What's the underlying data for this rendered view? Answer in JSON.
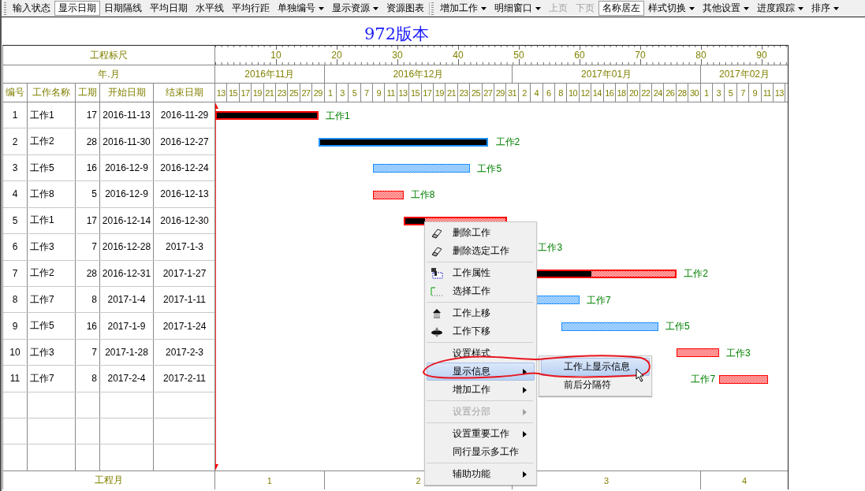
{
  "toolbar": {
    "items": [
      {
        "kind": "button",
        "label": "输入状态",
        "dropdown": false,
        "pressed": false,
        "disabled": false
      },
      {
        "kind": "button",
        "label": "显示日期",
        "dropdown": false,
        "pressed": true,
        "disabled": false
      },
      {
        "kind": "button",
        "label": "日期隔线",
        "dropdown": false,
        "pressed": false,
        "disabled": false
      },
      {
        "kind": "button",
        "label": "平均日期",
        "dropdown": false,
        "pressed": false,
        "disabled": false
      },
      {
        "kind": "button",
        "label": "水平线",
        "dropdown": false,
        "pressed": false,
        "disabled": false
      },
      {
        "kind": "button",
        "label": "平均行距",
        "dropdown": false,
        "pressed": false,
        "disabled": false
      },
      {
        "kind": "button",
        "label": "单独编号",
        "dropdown": true,
        "pressed": false,
        "disabled": false
      },
      {
        "kind": "button",
        "label": "显示资源",
        "dropdown": true,
        "pressed": false,
        "disabled": false
      },
      {
        "kind": "button",
        "label": "资源图表",
        "dropdown": false,
        "pressed": false,
        "disabled": false
      },
      {
        "kind": "separator"
      },
      {
        "kind": "button",
        "label": "增加工作",
        "dropdown": true,
        "pressed": false,
        "disabled": false
      },
      {
        "kind": "button",
        "label": "明细窗口",
        "dropdown": true,
        "pressed": false,
        "disabled": false
      },
      {
        "kind": "button",
        "label": "上页",
        "dropdown": false,
        "pressed": false,
        "disabled": true
      },
      {
        "kind": "button",
        "label": "下页",
        "dropdown": false,
        "pressed": false,
        "disabled": true
      },
      {
        "kind": "button",
        "label": "名称居左",
        "dropdown": false,
        "pressed": true,
        "disabled": false
      },
      {
        "kind": "button",
        "label": "样式切换",
        "dropdown": true,
        "pressed": false,
        "disabled": false
      },
      {
        "kind": "button",
        "label": "其他设置",
        "dropdown": true,
        "pressed": false,
        "disabled": false
      },
      {
        "kind": "button",
        "label": "进度跟踪",
        "dropdown": true,
        "pressed": false,
        "disabled": false
      },
      {
        "kind": "button",
        "label": "排序",
        "dropdown": true,
        "pressed": false,
        "disabled": false
      }
    ]
  },
  "title": "972版本",
  "header": {
    "ruler_title": "工程标尺",
    "month_title": "年.月",
    "columns": [
      "编号",
      "工作名称",
      "工期",
      "开始日期",
      "结束日期"
    ]
  },
  "timeline": {
    "ruler": [
      "10",
      "20",
      "30",
      "40",
      "50",
      "60",
      "70",
      "80",
      "90"
    ],
    "months": [
      {
        "label": "2016年11月"
      },
      {
        "label": "2016年12月"
      },
      {
        "label": "2017年01月"
      },
      {
        "label": "2017年02月"
      }
    ],
    "days": [
      "13",
      "15",
      "17",
      "19",
      "21",
      "23",
      "25",
      "27",
      "29",
      "1",
      "3",
      "5",
      "7",
      "9",
      "11",
      "13",
      "15",
      "17",
      "19",
      "21",
      "23",
      "25",
      "27",
      "29",
      "31",
      "2",
      "4",
      "6",
      "8",
      "10",
      "12",
      "14",
      "16",
      "18",
      "20",
      "22",
      "24",
      "26",
      "28",
      "30",
      "1",
      "3",
      "5",
      "7",
      "9",
      "11",
      "13"
    ]
  },
  "rows": [
    {
      "no": "1",
      "name": "工作1",
      "duration": "17",
      "start": "2016-11-13",
      "end": "2016-11-29",
      "critical": true,
      "level": 1,
      "bar_label": "工作1"
    },
    {
      "no": "2",
      "name": "工作2",
      "duration": "28",
      "start": "2016-11-30",
      "end": "2016-12-27",
      "critical": false,
      "level": 1,
      "bar_label": "工作2"
    },
    {
      "no": "3",
      "name": "工作5",
      "duration": "16",
      "start": "2016-12-9",
      "end": "2016-12-24",
      "critical": false,
      "bar_label": "工作5"
    },
    {
      "no": "4",
      "name": "工作8",
      "duration": "5",
      "start": "2016-12-9",
      "end": "2016-12-13",
      "critical": true,
      "bar_label": "工作8"
    },
    {
      "no": "5",
      "name": "工作1",
      "duration": "17",
      "start": "2016-12-14",
      "end": "2016-12-30",
      "critical": true,
      "level": 0.2
    },
    {
      "no": "6",
      "name": "工作3",
      "duration": "7",
      "start": "2016-12-28",
      "end": "2017-1-3",
      "bar_label": "工作3"
    },
    {
      "no": "7",
      "name": "工作2",
      "duration": "28",
      "start": "2016-12-31",
      "end": "2017-1-27",
      "critical": true,
      "level": 0.5,
      "bar_label": "工作2"
    },
    {
      "no": "8",
      "name": "工作7",
      "duration": "8",
      "start": "2017-1-4",
      "end": "2017-1-11",
      "critical": false,
      "bar_label": "工作7"
    },
    {
      "no": "9",
      "name": "工作5",
      "duration": "16",
      "start": "2017-1-9",
      "end": "2017-1-24",
      "critical": false,
      "bar_label": "工作5"
    },
    {
      "no": "10",
      "name": "工作3",
      "duration": "7",
      "start": "2017-1-28",
      "end": "2017-2-3",
      "critical": true,
      "bar_label": "工作3"
    },
    {
      "no": "11",
      "name": "工作7",
      "duration": "8",
      "start": "2017-2-4",
      "end": "2017-2-11",
      "critical": true,
      "bar_label": "工作7"
    }
  ],
  "footer": {
    "title": "工程月",
    "months": [
      "1",
      "2",
      "3",
      "4"
    ]
  },
  "context_menu": {
    "items": [
      {
        "kind": "item",
        "label": "删除工作",
        "disabled": false,
        "selected": false
      },
      {
        "kind": "item",
        "label": "删除选定工作",
        "disabled": false,
        "selected": false
      },
      {
        "kind": "separator"
      },
      {
        "kind": "item",
        "label": "工作属性",
        "disabled": false,
        "selected": false
      },
      {
        "kind": "item",
        "label": "选择工作",
        "disabled": false,
        "selected": false
      },
      {
        "kind": "separator"
      },
      {
        "kind": "item",
        "label": "工作上移",
        "disabled": false,
        "selected": false
      },
      {
        "kind": "item",
        "label": "工作下移",
        "disabled": false,
        "selected": false
      },
      {
        "kind": "separator"
      },
      {
        "kind": "item",
        "label": "设置样式",
        "disabled": false,
        "selected": false
      },
      {
        "kind": "item",
        "label": "显示信息",
        "submenu": true,
        "disabled": false,
        "selected": true
      },
      {
        "kind": "item",
        "label": "增加工作",
        "submenu": true,
        "disabled": false,
        "selected": false
      },
      {
        "kind": "separator"
      },
      {
        "kind": "item",
        "label": "设置分部",
        "submenu": true,
        "disabled": true,
        "selected": false
      },
      {
        "kind": "separator"
      },
      {
        "kind": "item",
        "label": "设置重要工作",
        "submenu": true,
        "disabled": false,
        "selected": false
      },
      {
        "kind": "item",
        "label": "同行显示多工作",
        "disabled": false,
        "selected": false
      },
      {
        "kind": "separator"
      },
      {
        "kind": "item",
        "label": "辅助功能",
        "submenu": true,
        "disabled": false,
        "selected": false
      }
    ]
  },
  "submenu": {
    "items": [
      {
        "kind": "item",
        "label": "工作上显示信息",
        "disabled": false,
        "selected": true
      },
      {
        "kind": "item",
        "label": "前后分隔符",
        "disabled": false,
        "selected": false
      }
    ]
  }
}
